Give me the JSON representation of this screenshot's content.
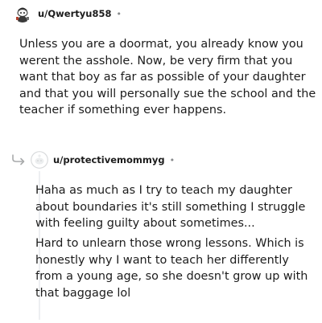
{
  "comments": [
    {
      "username": "u/Qwertyu858",
      "separator": "•",
      "avatar_icon": "snoo-avatar-icon",
      "body": "Unless you are a doormat, you already know you werent the asshole. Now, be very firm that you want that boy as far as possible of your daughter and that you will personally sue the school and the teacher if something ever happens."
    },
    {
      "username": "u/protectivemommyg",
      "separator": "•",
      "avatar_icon": "default-avatar-icon",
      "reply_icon": "reply-arrow-icon",
      "paragraphs": [
        "Haha as much as I try to teach my daughter about boundaries it's still something I struggle with feeling guilty about sometimes...",
        "Hard to unlearn those wrong lessons. Which is honestly why I want to teach her differently from a young age, so she doesn't grow up with that baggage lol"
      ]
    }
  ],
  "colors": {
    "text": "#1c1c1c",
    "meta": "#878a8c",
    "thread_line": "#edeff1",
    "reply_arrow": "#a8aaab"
  }
}
